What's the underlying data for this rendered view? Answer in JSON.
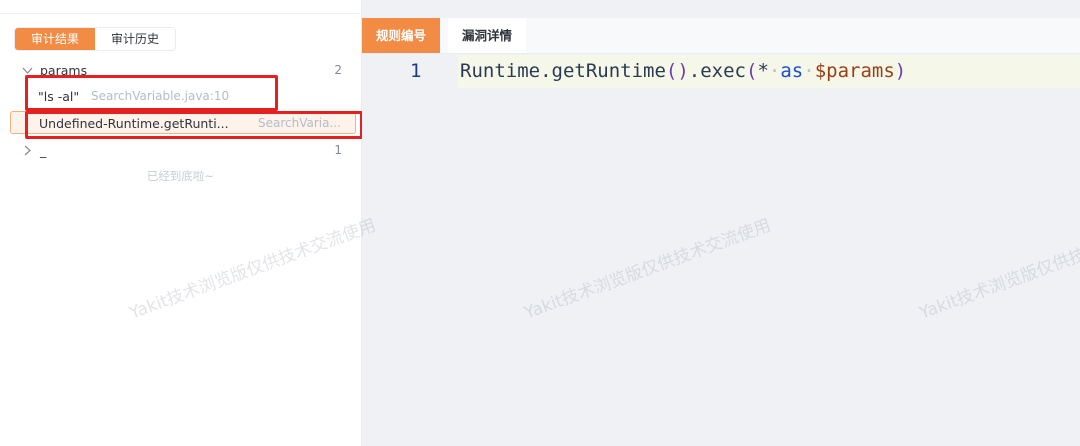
{
  "sidebar": {
    "tabs": [
      "审计结果",
      "审计历史"
    ],
    "groups": [
      {
        "label": "params",
        "count": "2",
        "expanded": true
      },
      {
        "label": "_",
        "count": "1",
        "expanded": false
      }
    ],
    "leaves": [
      {
        "name": "\"ls -al\"",
        "location": "SearchVariable.java:10"
      },
      {
        "name": "Undefined-Runtime.getRunti...",
        "location": "SearchVaria..."
      }
    ],
    "end_text": "已经到底啦~"
  },
  "editor": {
    "tabs": [
      "规则编号",
      "漏洞详情"
    ],
    "line_number": "1",
    "code_tokens": [
      "Runtime.getRuntime",
      "()",
      ".exec",
      "(",
      "*",
      "·",
      "as",
      "·",
      "$params",
      ")"
    ]
  },
  "watermark": "Yakit技术浏览版仅供技术交流使用",
  "colors": {
    "accent": "#f28b44",
    "highlight_red": "#e52020"
  }
}
